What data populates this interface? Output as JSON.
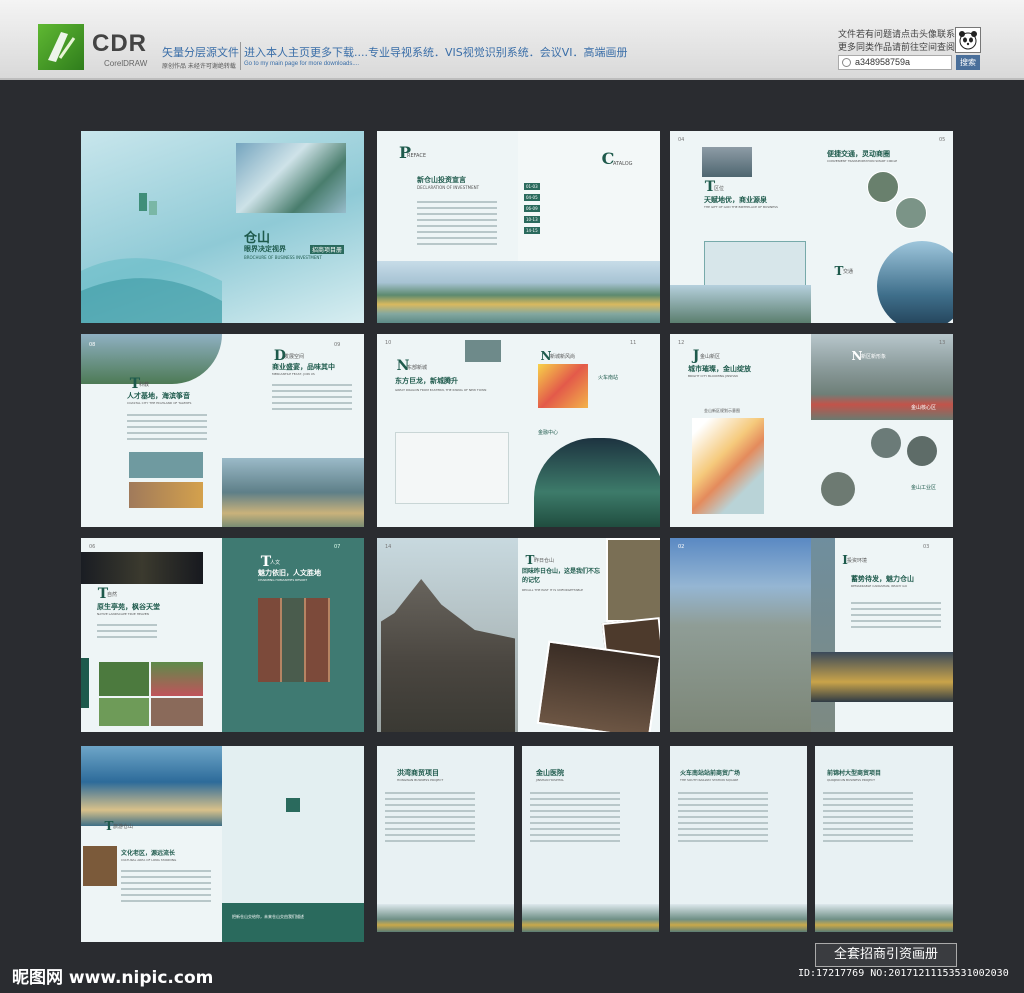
{
  "header": {
    "logo_text": "CDR",
    "logo_sub": "CorelDRAW",
    "line1": "矢量分层源文件",
    "line1_sub": "原创作品 未经许可谢绝转载",
    "line2": "进入本人主页更多下载....专业导视系统．VIS视觉识别系统．会议VI．高端画册",
    "line2_sub": "Go to my main page for more downloads....",
    "right1": "文件若有问题请点击头像联系",
    "right2": "更多同类作品请前往空间查阅",
    "search_value": "a348958759a",
    "search_button": "搜索"
  },
  "spreads": [
    {
      "left_title": "",
      "right_title": "仓山",
      "right_sub": "眼界决定视界",
      "right_en": "BROCHURE OF BUSINESS INVESTMENT",
      "right_tag": "招商项目册"
    },
    {
      "letter_l": "P",
      "label_l": "REFACE",
      "title_l": "新仓山投资宣言",
      "en_l": "DECLARATION OF INVESTMENT",
      "letter_r": "C",
      "label_r": "ATALOG",
      "catalog": [
        "01-03",
        "04-05",
        "06-09",
        "10-13",
        "14-15"
      ]
    },
    {
      "pn_l": "04",
      "letter_l": "T",
      "label_l": "区位",
      "title_l": "天赋地优，商业源泉",
      "en_l": "THE GIFT OF GOD THE BIRTHPLACE OF BUSINESS",
      "pn_r": "05",
      "title_r": "便捷交通，灵动商圈",
      "en_r": "CONVENIENT TRANSPORTATION SMART CIRCLE",
      "letter_r": "T",
      "label_r": "交通"
    },
    {
      "pn_l": "08",
      "letter_l": "T",
      "label_l": "科教",
      "title_l": "人才基地，海滨筝音",
      "en_l": "COASTAL CITY THE HIGHLAND OF TALENTS",
      "pn_r": "09",
      "letter_r": "D",
      "label_r": "发展空间",
      "title_r": "商业盛宴，品味其中",
      "en_r": "MERCANTILE FEAST, JOIN US"
    },
    {
      "pn_l": "10",
      "letter_l": "N",
      "label_l": "东部新城",
      "title_l": "东方巨龙，新城腾升",
      "en_l": "GREAT DRAGON FROM EASTERN, THE RISING OF NEW TOWN",
      "pn_r": "11",
      "letter_r": "N",
      "label_r": "新城新风尚",
      "tag_r1": "火车南站",
      "tag_r2": "金融中心"
    },
    {
      "pn_l": "12",
      "letter_l": "J",
      "label_l": "金山新区",
      "title_l": "城市璀璨，金山绽放",
      "en_l": "BRIGHT CITY BLOOMING JINSHAN",
      "map_caption": "金山新区规划示意图",
      "pn_r": "13",
      "letter_r": "N",
      "label_r": "新区新形象",
      "tag_r1": "金山核心区",
      "tag_r2": "金山工业区"
    },
    {
      "pn_l": "06",
      "letter_l": "T",
      "label_l": "自然",
      "title_l": "原生亭苑，枫谷天堂",
      "en_l": "NATIVE LANDSCAPE TRUE HEAVEN",
      "pn_r": "07",
      "letter_r": "T",
      "label_r": "人文",
      "title_r": "魅力依旧，人文胜地",
      "en_r": "CHARMING HUMANITIES RESORT"
    },
    {
      "pn_l": "14",
      "letter_r": "T",
      "label_r": "昨日仓山",
      "title_r": "回味昨日仓山，这是我们不忘的记忆",
      "en_r": "RECALL THE PAST IT IS UNFORGETTABLE"
    },
    {
      "pn_l": "02",
      "pn_r": "03",
      "letter_r": "I",
      "label_r": "投资环境",
      "title_r": "蓄势待发，魅力仓山",
      "en_r": "REMARKABLE CANGSHAN, READY GO"
    },
    {
      "letter_l": "T",
      "label_l": "旅游仓山",
      "title_l": "文化老区，源远流长",
      "en_l": "CULTURAL AREA OF LONG STANDING",
      "right_note": "把新仓山交给你，未来仓山交由我们描述"
    },
    {
      "title": "洪湾商贸项目",
      "en": "HONGWAN BUSINESS PROJECT"
    },
    {
      "title": "金山医院",
      "en": "JINSHAN HOSPITAL"
    },
    {
      "title": "火车南站站前商贸广场",
      "en": "THE SOUTH RAILWAY STATION SQUARE"
    },
    {
      "title": "前锦村大型商贸项目",
      "en": "QIANJINCUN BUSINESS PROJECT"
    }
  ],
  "footer": {
    "site": "昵图网 www.nipic.com",
    "box_label": "全套招商引资画册",
    "id_line": "ID:17217769 NO:20171211153531002030"
  },
  "colors": {
    "accent": "#1e5a4c",
    "teal": "#2a6a5d",
    "page_bg": "#e8f1f3",
    "bg": "#2a2c30"
  }
}
